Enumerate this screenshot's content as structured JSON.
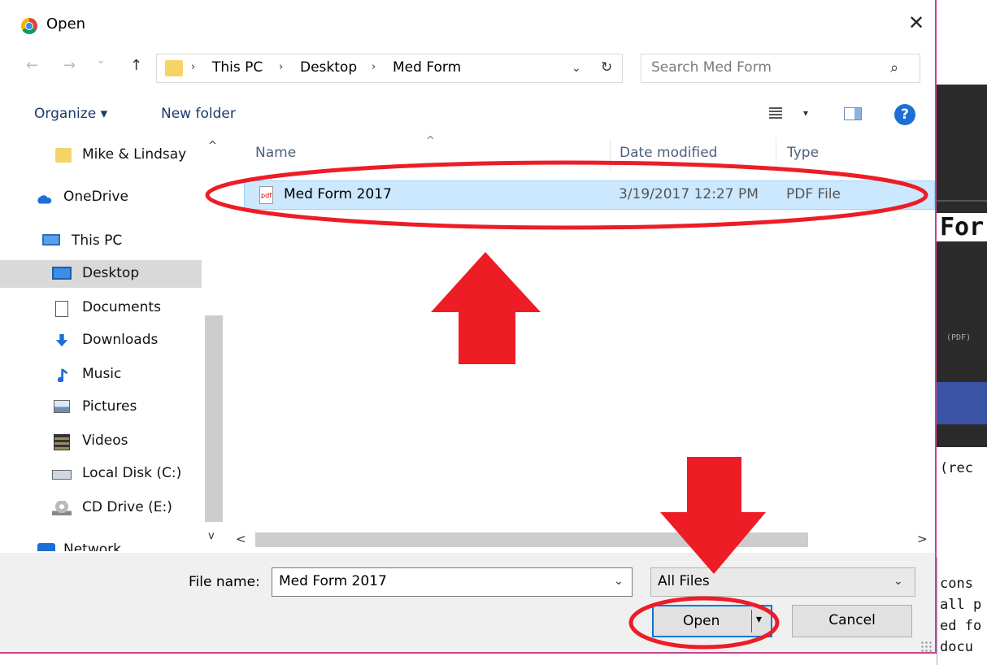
{
  "window": {
    "title": "Open",
    "close_glyph": "✕",
    "app_icon": "chrome-icon"
  },
  "nav_buttons": {
    "back": "←",
    "forward": "→",
    "recent": "⌄",
    "up": "↑"
  },
  "address": {
    "crumbs": [
      "This PC",
      "Desktop",
      "Med Form"
    ],
    "separator": "›",
    "dropdown": "⌄",
    "refresh": "↻"
  },
  "search": {
    "placeholder": "Search Med Form",
    "icon": "⌕"
  },
  "toolbar": {
    "organize": "Organize ▾",
    "new_folder": "New folder",
    "view_drop": "▾",
    "help": "?"
  },
  "sidebar": {
    "items": [
      {
        "label": "Mike & Lindsay",
        "icon": "folder-icon"
      },
      {
        "label": "OneDrive",
        "icon": "cloud-icon"
      },
      {
        "label": "This PC",
        "icon": "computer-icon"
      },
      {
        "label": "Desktop",
        "icon": "desktop-icon",
        "selected": true
      },
      {
        "label": "Documents",
        "icon": "documents-icon"
      },
      {
        "label": "Downloads",
        "icon": "downloads-icon"
      },
      {
        "label": "Music",
        "icon": "music-icon"
      },
      {
        "label": "Pictures",
        "icon": "pictures-icon"
      },
      {
        "label": "Videos",
        "icon": "videos-icon"
      },
      {
        "label": "Local Disk (C:)",
        "icon": "disk-icon"
      },
      {
        "label": "CD Drive (E:)",
        "icon": "cd-drive-icon"
      },
      {
        "label": "Network",
        "icon": "network-icon"
      }
    ],
    "scroll_up": "^",
    "scroll_down": "v"
  },
  "file_list": {
    "columns": [
      "Name",
      "Date modified",
      "Type"
    ],
    "sort_caret": "^",
    "rows": [
      {
        "name": "Med Form 2017",
        "date": "3/19/2017 12:27 PM",
        "type": "PDF File",
        "icon": "pdf-file-icon",
        "icon_text": "pdf"
      }
    ],
    "scroll_left": "<",
    "scroll_right": ">"
  },
  "footer": {
    "file_name_label": "File name:",
    "file_name_value": "Med Form 2017",
    "file_name_drop": "⌄",
    "file_type_value": "All Files",
    "file_type_drop": "⌄",
    "open": "Open",
    "open_drop": "▾",
    "cancel": "Cancel"
  },
  "background_page": {
    "fragments": [
      "For",
      "(PDF)",
      "(rec",
      "cons",
      "all p",
      "ed fo",
      "docu"
    ]
  },
  "colors": {
    "accent": "#0078d7",
    "annotation": "#ee1c25",
    "selection": "#cce8ff",
    "window_border": "#c9438a"
  }
}
